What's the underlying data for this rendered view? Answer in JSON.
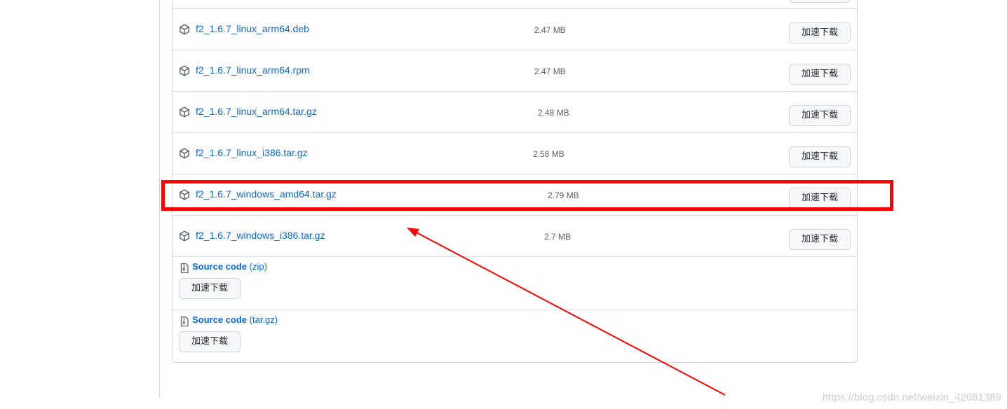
{
  "assets": [
    {
      "name": "f2_1.6.7_linux_arm64.deb",
      "size": "2.47 MB",
      "button": "加速下载"
    },
    {
      "name": "f2_1.6.7_linux_arm64.rpm",
      "size": "2.47 MB",
      "button": "加速下载"
    },
    {
      "name": "f2_1.6.7_linux_arm64.tar.gz",
      "size": "2.48 MB",
      "button": "加速下载"
    },
    {
      "name": "f2_1.6.7_linux_i386.tar.gz",
      "size": "2.58 MB",
      "button": "加速下载"
    },
    {
      "name": "f2_1.6.7_windows_amd64.tar.gz",
      "size": "2.79 MB",
      "button": "加速下载"
    },
    {
      "name": "f2_1.6.7_windows_i386.tar.gz",
      "size": "2.7 MB",
      "button": "加速下载"
    }
  ],
  "sources": [
    {
      "label": "Source code",
      "ext": "(zip)",
      "button": "加速下载"
    },
    {
      "label": "Source code",
      "ext": "(tar.gz)",
      "button": "加速下载"
    }
  ],
  "watermark": "https://blog.csdn.net/weixin_42081389",
  "colors": {
    "link": "#0969da",
    "highlight": "#ff0000",
    "arrow": "#ff0000"
  },
  "icons": {
    "asset": "package-icon",
    "source": "file-zip-icon"
  }
}
